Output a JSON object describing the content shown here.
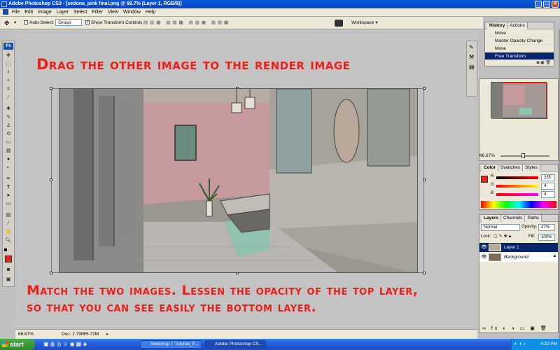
{
  "window": {
    "title": "Adobe Photoshop CS3 - [sedona_pink final.png @ 66.7% (Layer 1, RGB/8)]"
  },
  "menu": [
    "File",
    "Edit",
    "Image",
    "Layer",
    "Select",
    "Filter",
    "View",
    "Window",
    "Help"
  ],
  "options": {
    "auto_select_label": "Auto-Select:",
    "auto_select_value": "Group",
    "transform_controls_label": "Show Transform Controls",
    "workspace_label": "Workspace"
  },
  "annotations": {
    "top": "Drag the other image to the render image",
    "bottom_line1": "Match the two images. Lessen the opacity of the top layer,",
    "bottom_line2": "so that you can see easily the bottom layer."
  },
  "status": {
    "zoom": "66.67%",
    "doc": "Doc: 2.79M/5.72M"
  },
  "history": {
    "tabs": [
      "History",
      "Actions"
    ],
    "items": [
      "Move",
      "Master Opacity Change",
      "Move",
      "Free Transform"
    ]
  },
  "navigator": {
    "zoom": "66.67%"
  },
  "color": {
    "tabs": [
      "Color",
      "Swatches",
      "Styles"
    ],
    "r_label": "R",
    "g_label": "G",
    "b_label": "B",
    "r": "255",
    "g": "4",
    "b": "4",
    "foreground": "#e8211a"
  },
  "layers": {
    "tabs": [
      "Layers",
      "Channels",
      "Paths"
    ],
    "blend_mode": "Normal",
    "opacity_label": "Opacity:",
    "opacity_value": "47%",
    "lock_label": "Lock:",
    "fill_label": "Fill:",
    "fill_value": "100%",
    "items": [
      "Layer 1",
      "Background"
    ]
  },
  "taskbar": {
    "start": "start",
    "items": [
      "Sketchup 7 Tutorial_P...",
      "Adobe Photoshop CS..."
    ],
    "clock": "4:22 PM"
  }
}
